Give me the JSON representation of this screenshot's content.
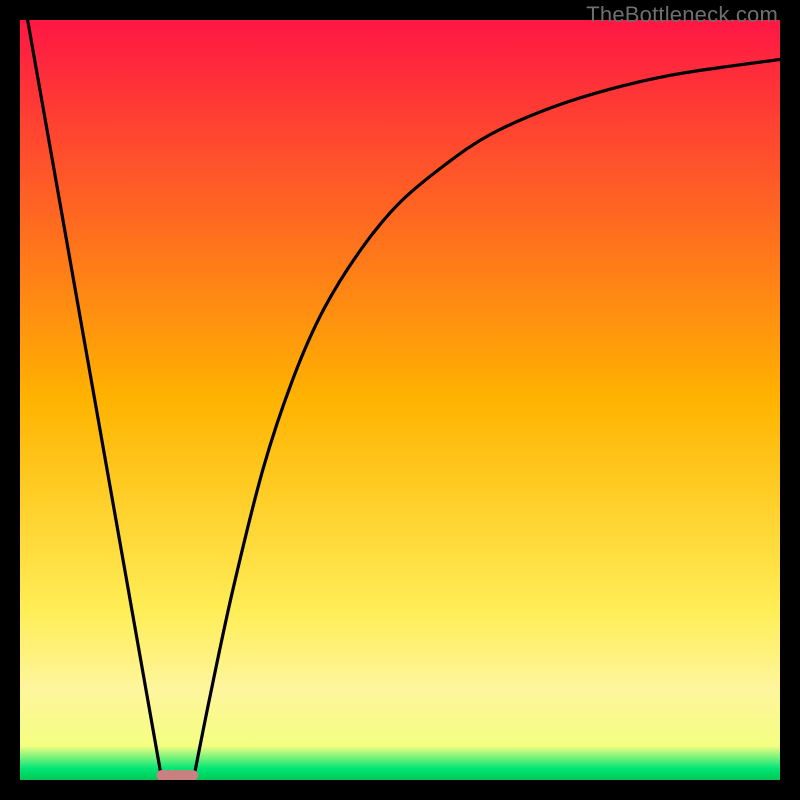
{
  "watermark": "TheBottleneck.com",
  "chart_data": {
    "type": "line",
    "title": "",
    "xlabel": "",
    "ylabel": "",
    "xlim": [
      0,
      100
    ],
    "ylim": [
      0,
      100
    ],
    "grid": false,
    "legend": false,
    "background_gradient": {
      "stops": [
        {
          "pos": 0.0,
          "color": "#ff1744"
        },
        {
          "pos": 0.5,
          "color": "#ffb300"
        },
        {
          "pos": 0.78,
          "color": "#ffee58"
        },
        {
          "pos": 0.88,
          "color": "#fff59d"
        },
        {
          "pos": 0.955,
          "color": "#f4ff81"
        },
        {
          "pos": 0.985,
          "color": "#00e676"
        },
        {
          "pos": 1.0,
          "color": "#00c853"
        }
      ]
    },
    "baseline_marker": {
      "x_center": 20.7,
      "y": 0.6,
      "width": 5.5,
      "height": 1.4,
      "color": "#c98080",
      "border_radius": 1.0
    },
    "series": [
      {
        "name": "left-leg",
        "segment": "line",
        "points": [
          {
            "x": 1.0,
            "y": 100.0
          },
          {
            "x": 18.5,
            "y": 1.0
          }
        ]
      },
      {
        "name": "right-curve",
        "segment": "curve",
        "points": [
          {
            "x": 23.0,
            "y": 1.0
          },
          {
            "x": 25.0,
            "y": 11.0
          },
          {
            "x": 28.0,
            "y": 25.0
          },
          {
            "x": 32.0,
            "y": 41.0
          },
          {
            "x": 36.0,
            "y": 53.0
          },
          {
            "x": 40.0,
            "y": 62.0
          },
          {
            "x": 45.0,
            "y": 70.0
          },
          {
            "x": 50.0,
            "y": 76.0
          },
          {
            "x": 56.0,
            "y": 81.0
          },
          {
            "x": 62.0,
            "y": 85.0
          },
          {
            "x": 70.0,
            "y": 88.5
          },
          {
            "x": 78.0,
            "y": 91.0
          },
          {
            "x": 86.0,
            "y": 92.8
          },
          {
            "x": 94.0,
            "y": 94.0
          },
          {
            "x": 100.0,
            "y": 94.8
          }
        ]
      }
    ]
  }
}
